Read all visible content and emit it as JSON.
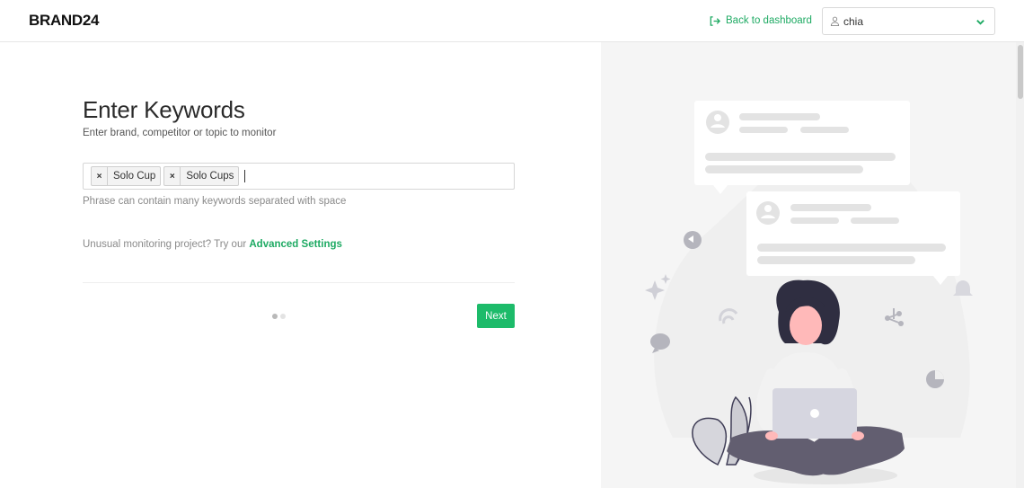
{
  "header": {
    "logo": "BRAND24",
    "back_link": "Back to dashboard",
    "user_name": "chia",
    "icons": {
      "back": "logout-arrow-icon",
      "user": "user-icon",
      "chevron": "chevron-down-icon"
    }
  },
  "main": {
    "title": "Enter Keywords",
    "subtitle": "Enter brand, competitor or topic to monitor",
    "keywords": [
      "Solo Cup",
      "Solo Cups"
    ],
    "tag_remove": "×",
    "hint": "Phrase can contain many keywords separated with space",
    "unusual_prefix": "Unusual monitoring project? Try our ",
    "advanced_link": "Advanced Settings",
    "next_button": "Next",
    "step_current": 1,
    "step_total": 2
  },
  "colors": {
    "accent": "#1dbb6a",
    "link": "#1eaa63",
    "illustration_bg": "#f5f5f5",
    "person_hair": "#2f2e41",
    "person_skin": "#ffb9b9",
    "person_pants": "#625e70",
    "laptop": "#d6d6e0"
  }
}
